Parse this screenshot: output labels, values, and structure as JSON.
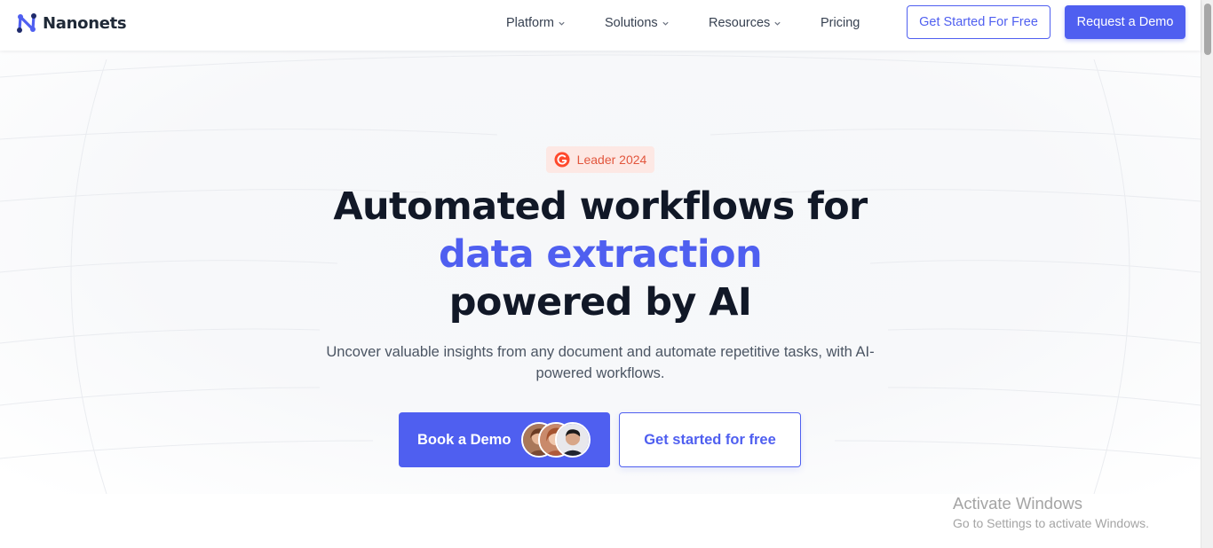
{
  "colors": {
    "accent": "#4f5ff0",
    "heading": "#111827",
    "body_text": "#4b5563",
    "badge_bg": "#fde8e4",
    "badge_text": "#e2563d"
  },
  "nav": {
    "logo_text": "Nanonets",
    "logo_icon": "nanonets-logo-icon",
    "links": [
      {
        "label": "Platform",
        "has_dropdown": true
      },
      {
        "label": "Solutions",
        "has_dropdown": true
      },
      {
        "label": "Resources",
        "has_dropdown": true
      },
      {
        "label": "Pricing",
        "has_dropdown": false
      }
    ],
    "get_started_label": "Get Started For Free",
    "request_demo_label": "Request a Demo"
  },
  "hero": {
    "badge": {
      "icon": "g2-icon",
      "label": "Leader 2024"
    },
    "headline_line1": "Automated workflows for",
    "headline_line2": "data extraction",
    "headline_line3": "powered by AI",
    "subtext": "Uncover valuable insights from any document and automate repetitive tasks, with AI-powered workflows.",
    "book_demo_label": "Book a Demo",
    "avatar_count": 3,
    "get_started_label": "Get started for free"
  },
  "watermark": {
    "title": "Activate Windows",
    "subtitle": "Go to Settings to activate Windows."
  }
}
